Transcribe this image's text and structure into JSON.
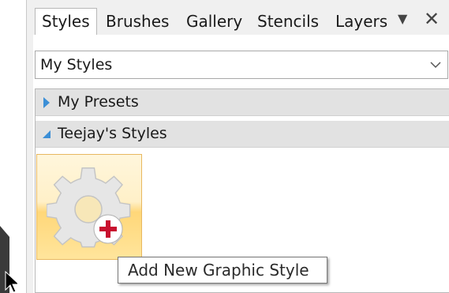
{
  "tabs": [
    {
      "label": "Styles",
      "active": true
    },
    {
      "label": "Brushes",
      "active": false
    },
    {
      "label": "Gallery",
      "active": false
    },
    {
      "label": "Stencils",
      "active": false
    },
    {
      "label": "Layers",
      "active": false
    }
  ],
  "tab_menu_icon": "dropdown-triangle-icon",
  "tab_close_icon": "close-icon",
  "style_set_dropdown": {
    "value": "My Styles",
    "icon": "chevron-down-icon"
  },
  "groups": [
    {
      "label": "My Presets",
      "expanded": false
    },
    {
      "label": "Teejay's Styles",
      "expanded": true
    }
  ],
  "style_tile": {
    "icon": "gear-add-icon",
    "selected": true
  },
  "tooltip": {
    "text": "Add New Graphic Style"
  },
  "colors": {
    "accent_arrow": "#3c8fd6",
    "tile_highlight": "#ffd779",
    "plus_badge": "#c8102e"
  }
}
